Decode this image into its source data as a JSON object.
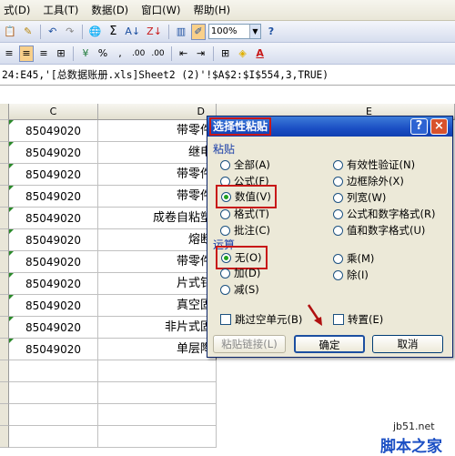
{
  "menubar": {
    "items": [
      "式(D)",
      "工具(T)",
      "数据(D)",
      "窗口(W)",
      "帮助(H)"
    ]
  },
  "toolbar": {
    "zoom": "100%",
    "currency": "%",
    "decimals_inc": ".00",
    "decimals_dec": ".00"
  },
  "formula_bar": {
    "text": "24:E45,'[总数据账册.xls]Sheet2 (2)'!$A$2:$I$554,3,TRUE)"
  },
  "sheet": {
    "col_c": "C",
    "col_d": "D",
    "col_e": "E",
    "rows": [
      {
        "c": "85049020",
        "d": "带零件"
      },
      {
        "c": "85049020",
        "d": "继电"
      },
      {
        "c": "85049020",
        "d": "带零件"
      },
      {
        "c": "85049020",
        "d": "带零件"
      },
      {
        "c": "85049020",
        "d": "成卷自粘塑"
      },
      {
        "c": "85049020",
        "d": "熔断"
      },
      {
        "c": "85049020",
        "d": "带零件"
      },
      {
        "c": "85049020",
        "d": "片式钅"
      },
      {
        "c": "85049020",
        "d": "真空固"
      },
      {
        "c": "85049020",
        "d": "非片式固"
      },
      {
        "c": "85049020",
        "d": "单层陶"
      }
    ]
  },
  "dialog": {
    "title": "选择性粘贴",
    "help": "?",
    "close": "×",
    "paste_group": "粘贴",
    "paste_left": [
      "全部(A)",
      "公式(F)",
      "数值(V)",
      "格式(T)",
      "批注(C)"
    ],
    "paste_right": [
      "有效性验证(N)",
      "边框除外(X)",
      "列宽(W)",
      "公式和数字格式(R)",
      "值和数字格式(U)"
    ],
    "paste_selected": "数值(V)",
    "op_group": "运算",
    "op_left": [
      "无(O)",
      "加(D)",
      "减(S)"
    ],
    "op_right": [
      "乘(M)",
      "除(I)"
    ],
    "op_selected": "无(O)",
    "skip_blanks": "跳过空单元(B)",
    "transpose": "转置(E)",
    "paste_link": "粘贴链接(L)",
    "ok": "确定",
    "cancel": "取消",
    "colors": {
      "highlight": "#c81818",
      "title_bar": "#1b4fc4",
      "radio_dot": "#21a121"
    }
  },
  "watermark": {
    "site": "jb51.net",
    "name": "脚本之家"
  }
}
